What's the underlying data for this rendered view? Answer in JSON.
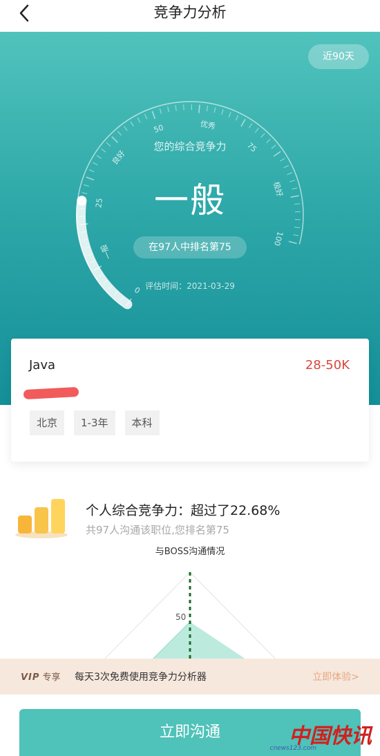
{
  "header": {
    "title": "竞争力分析",
    "back_icon": "chevron-left-icon"
  },
  "hero": {
    "range_button": "近90天",
    "gauge": {
      "caption": "您的综合竞争力",
      "level": "一般",
      "rank_text": "在97人中排名第75",
      "eval_time": "评估时间：2021-03-29",
      "scale_labels": [
        "0",
        "一般",
        "25",
        "良好",
        "50",
        "优秀",
        "75",
        "极好",
        "100"
      ],
      "progress_fraction": 0.25
    }
  },
  "job_card": {
    "job_name": "Java",
    "salary": "28-50K",
    "tags": [
      "北京",
      "1-3年",
      "本科"
    ]
  },
  "competitiveness": {
    "icon": "bar-chart-icon",
    "title": "个人综合竞争力：超过了22.68%",
    "subtitle": "共97人沟通该职位,您排名第75",
    "radar_title": "与BOSS沟通情况",
    "radar_tick": "50"
  },
  "vip_banner": {
    "badge_vip": "VIP",
    "badge_text": "专享",
    "text": "每天3次免费使用竞争力分析器",
    "cta": "立即体验>"
  },
  "bottom_button": {
    "label": "立即沟通"
  },
  "watermark": {
    "main": "中国快讯",
    "sub": "cnews123.com"
  },
  "colors": {
    "teal_top": "#51c3bd",
    "teal_bottom": "#148f98",
    "salary_red": "#d9483b",
    "cta_teal": "#4fc2b9",
    "vip_bg": "#f7e8de"
  }
}
